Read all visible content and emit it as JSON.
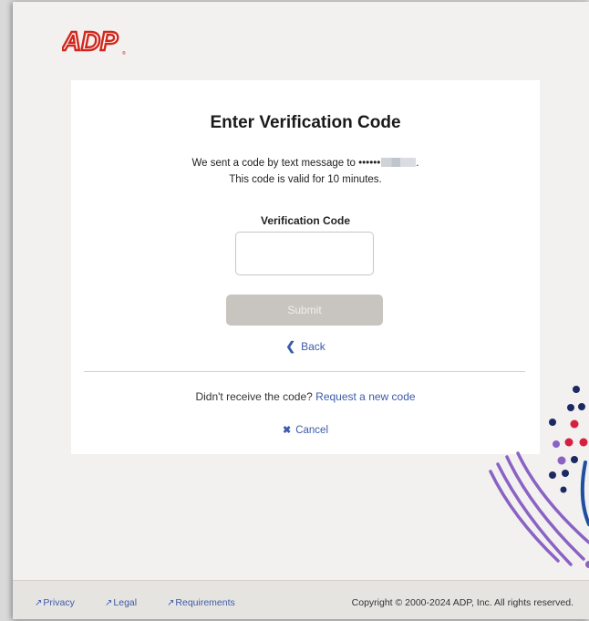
{
  "brand": {
    "logo_text": "ADP",
    "logo_color": "#d0271d"
  },
  "card": {
    "title": "Enter Verification Code",
    "message_line1_prefix": "We sent a code by text message to ",
    "message_line1_masked": "••••••",
    "message_line2": "This code is valid for 10 minutes.",
    "field_label": "Verification Code",
    "input_value": "",
    "input_placeholder": "",
    "submit_label": "Submit",
    "back_label": "Back",
    "resend_prefix": "Didn't receive the code?",
    "resend_link": "Request a new code",
    "cancel_label": "Cancel"
  },
  "footer": {
    "links": [
      "Privacy",
      "Legal",
      "Requirements"
    ],
    "copyright": "Copyright © 2000-2024 ADP, Inc. All rights reserved."
  },
  "colors": {
    "accent": "#3c5ba7",
    "brand_red": "#d0271d",
    "submit_disabled": "#c8c4bf",
    "background": "#f2f1ef",
    "decor_navy": "#1b2a63",
    "decor_purple": "#8a62c4",
    "decor_red": "#d71f3f",
    "decor_blue": "#1f4fa0"
  },
  "icons": {
    "back": "chevron-left-icon",
    "cancel": "close-icon",
    "external": "external-link-icon"
  }
}
